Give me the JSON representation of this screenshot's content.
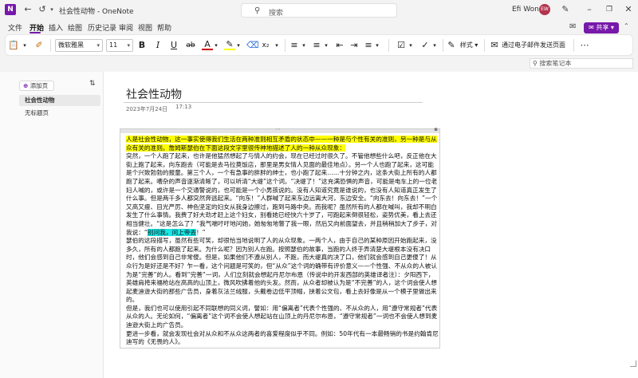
{
  "window": {
    "title": "社会性动物 - OneNote",
    "search_placeholder": "搜索",
    "user_name": "Efi Wong",
    "user_initials": "EW"
  },
  "menu": {
    "items": [
      "文件",
      "开始",
      "插入",
      "绘图",
      "历史记录",
      "审阅",
      "视图",
      "帮助"
    ],
    "active": "开始",
    "share_label": "共享"
  },
  "ribbon": {
    "font_name": "微软雅黑",
    "font_size": "11",
    "styles_label": "样式",
    "email_label": "通过电子邮件发送页面"
  },
  "subbar": {
    "search_notebook": "搜索笔记本"
  },
  "sidebar": {
    "add_page_label": "添加页",
    "pages": [
      "社会性动物",
      "无标题页"
    ],
    "selected": "社会性动物"
  },
  "page": {
    "title": "社会性动物",
    "date": "2023年7月24日",
    "time": "17:13"
  },
  "note": {
    "highlight_intro": "人是社会性动物，这一事实使得我们生活在两种准则相互矛盾的状态中——一种是与个性有关的准则，另一种是与从众有关的准则。詹姆斯瑟伯在下面这段文字里很传神地描述了人的一种从众现象：",
    "para1_before": "突然，一个人跑了起来，也许是他猛然想起了与情人的约会，现在已经过时很久了。不管他想些什么吧，反正他在大街上跑了起来，向东跑去（可能是去马拉莫饭店，那里是男女情人见面的最佳地点）。另一个人也跑了起来，这可能是个兴致勃勃的报童。第三个人，一个有急事的胖胖的绅士，也小跑了起来……十分钟之内，这条大街上所有的人都跑了起来。嘈杂的声音逐渐清晰了，可以听清“大堤”这个词。“决堤了！”这充满恐惧的声音，可能是电车上的一位老妇人喊的，或许是一个交通警说的，也可能是一个小男孩说的。没有人知道究竟是谁说的，也没有人知道真正发生了什么事。但是两千多人都突然奔逃起来。“向东！”人群喊了起来东边远离大河，东边安全。“向东去！向东去！”一个又高又瘦、目光严厉、神色坚定的妇女从我身边擦过，跑到马路中央。而我呢？虽然所有的人都在喊叫，我却不明白发生了什么事情。我费了好大劲才赶上这个妇女，别看她已经快六十岁了，可跑起来倒很轻松，姿势优美，看上去还相当健壮。“这是怎么了？”我气喘吁吁地问她，她匆匆地瞥了我一眼，然后又向前面望去，并且稍稍加大了步子，对我说：“",
    "para1_highlight": "别问我，问上帝去",
    "para1_after": "！”",
    "para2": "瑟伯的这段描写，虽然有些可笑，却很恰当地说明了人的从众现象。一两个人，由于自己的某种原因开始跑起来，没多久，所有的人都跑了起来。为什么呢？因为别人在跑。按照瑟伯的故事，当跑的人终于弄清楚大堤根本没有决口时，他们会感到自己非常傻。但是，如果他们不遵从别人，不跑，而大堤真的决了口，他们就会感到自己更傻了！从众行为是好还是不好？乍一看，这个问题是可笑的，但“从众”这个词的确带有评价意义——个性强、不从众的人被认为是“完善”的人。看到“完善”一词，人们立刻就会想起丹尼尔布恩（传说中的开发西部的英雄译者注）：夕阳西下，英雄肩挎来福枪站在高高的山顶上，微风吹拂着他的头发。然而，从众者却被认为是“不完善”的人，这个词会使人想起麦迪逊大街的那些广告员，身着灰法兰绒服，头戴卷边低平顶帽，挟着公文包，看上去好像是从一个模子里做出来的。",
    "para3": "但是，我们也可以使用引起不同联想的同义词，譬如：用“偏离者”代表个性强的、不从众的人，用“遵守常规者”代表从众的人。无论如何，“偏离者”这个词不会使人想起站在山顶上的丹尼尔布恩，“遵守常规者”一词也不会使人想到麦迪逊大街上的广告员。",
    "para4": "更进一步看，就会发现社会对从众和不从众这两者的喜爱程度似乎不同。例如：50年代有一本最畅销的书是约翰肯尼迪写的《无畏的人》。"
  },
  "colors": {
    "accent": "#7719aa",
    "highlight_yellow": "#ffff00",
    "highlight_cyan": "#19e6e6"
  }
}
